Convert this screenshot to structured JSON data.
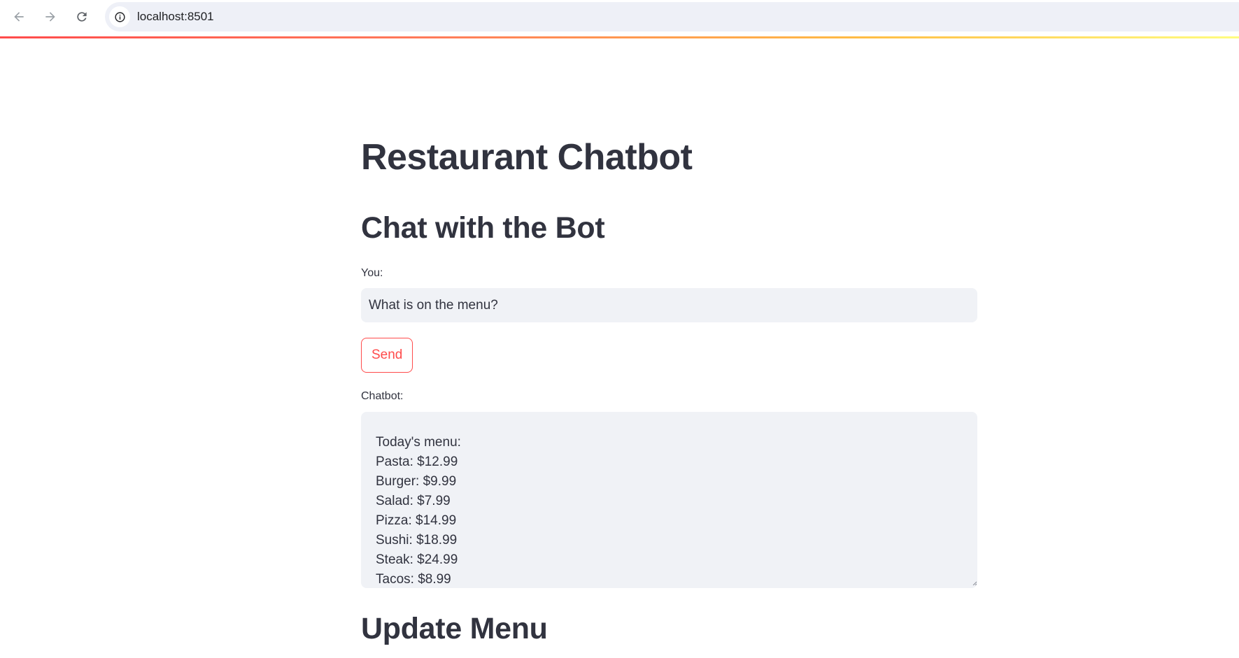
{
  "browser": {
    "url": "localhost:8501",
    "back_icon": "arrow-left-icon",
    "forward_icon": "arrow-right-icon",
    "reload_icon": "reload-icon",
    "site_info_icon": "info-icon"
  },
  "theme": {
    "primary": "#ff4b4b",
    "text": "#31333f",
    "input_bg": "#f0f2f6"
  },
  "page": {
    "title": "Restaurant Chatbot",
    "chat_section_title": "Chat with the Bot",
    "you_label": "You:",
    "you_value": "What is on the menu?",
    "send_label": "Send",
    "chatbot_label": "Chatbot:",
    "chatbot_response": "\nToday's menu:\nPasta: $12.99\nBurger: $9.99\nSalad: $7.99\nPizza: $14.99\nSushi: $18.99\nSteak: $24.99\nTacos: $8.99",
    "update_section_title": "Update Menu"
  }
}
